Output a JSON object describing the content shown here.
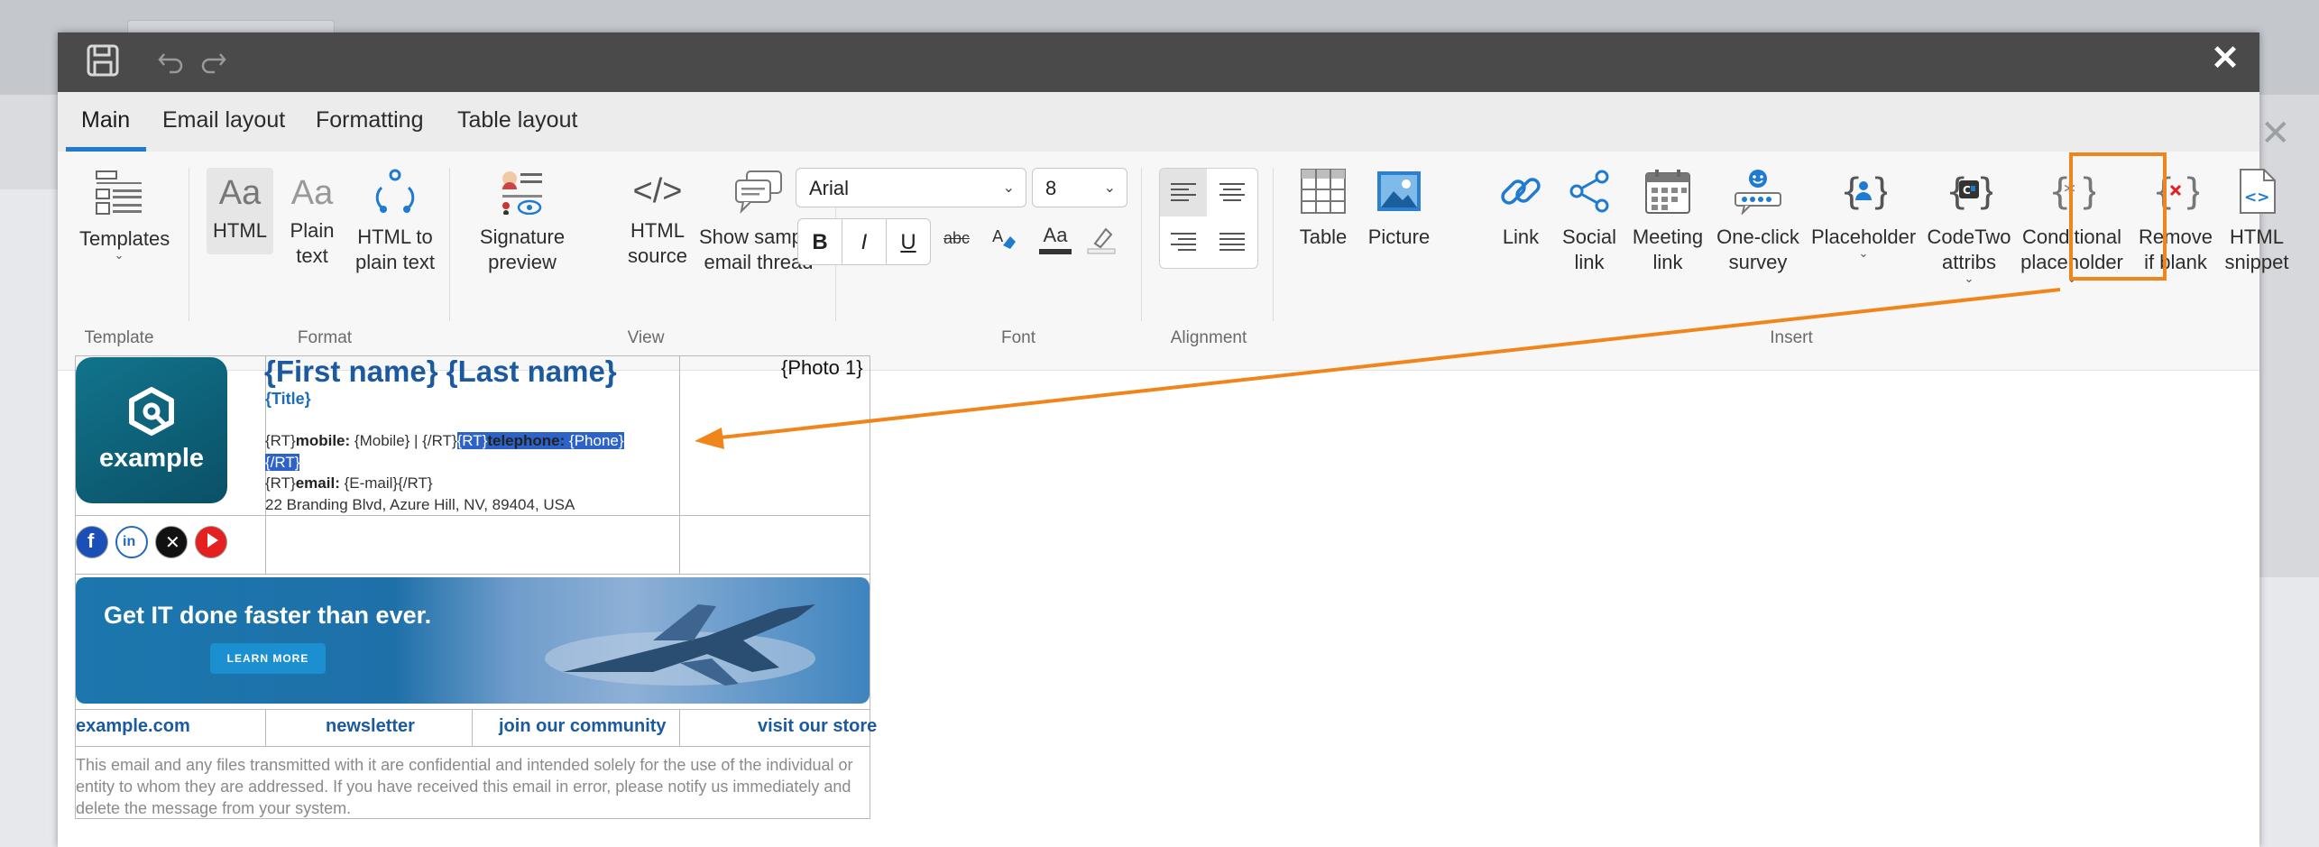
{
  "toolbar": {
    "save_icon": "save-icon",
    "undo_icon": "undo-icon",
    "redo_icon": "redo-icon",
    "close_label": "✕"
  },
  "tabs": [
    {
      "label": "Main",
      "active": true
    },
    {
      "label": "Email layout"
    },
    {
      "label": "Formatting"
    },
    {
      "label": "Table layout"
    }
  ],
  "ribbon": {
    "template": {
      "templates": "Templates",
      "group": "Template"
    },
    "format": {
      "html": "HTML",
      "plain_text_1": "Plain",
      "plain_text_2": "text",
      "html_to_plain_1": "HTML to",
      "html_to_plain_2": "plain text",
      "group": "Format"
    },
    "view": {
      "sig_preview_1": "Signature",
      "sig_preview_2": "preview",
      "html_source_1": "HTML",
      "html_source_2": "source",
      "sample_1": "Show sample",
      "sample_2": "email thread",
      "group": "View"
    },
    "font": {
      "family": "Arial",
      "size": "8",
      "bold": "B",
      "italic": "I",
      "underline": "U",
      "strike": "abc",
      "font_color": "Aa",
      "group": "Font"
    },
    "alignment": {
      "group": "Alignment"
    },
    "insert": {
      "table": "Table",
      "picture": "Picture",
      "link": "Link",
      "social_1": "Social",
      "social_2": "link",
      "meeting_1": "Meeting",
      "meeting_2": "link",
      "survey_1": "One-click",
      "survey_2": "survey",
      "placeholder": "Placeholder",
      "codetwo_1": "CodeTwo",
      "codetwo_2": "attribs",
      "conditional_1": "Conditional",
      "conditional_2": "placeholder",
      "remove_1": "Remove",
      "remove_2": "if blank",
      "snippet_1": "HTML",
      "snippet_2": "snippet",
      "group": "Insert"
    }
  },
  "signature": {
    "logo_text": "example",
    "name": "{First name} {Last name}",
    "title": "{Title}",
    "photo": "{Photo 1}",
    "mobile_prefix": "{RT}",
    "mobile_label": "mobile:",
    "mobile_value": " {Mobile}  |  {/RT}",
    "tel_highlight": "{RT}",
    "tel_label": "telephone:",
    "tel_value": " {Phone}",
    "tel_end": "{/RT}",
    "email_prefix": "{RT}",
    "email_label": "email:",
    "email_value": " {E-mail}{/RT}",
    "address": "22 Branding Blvd, Azure Hill, NV, 89404, USA",
    "banner_headline_1": "Get ",
    "banner_headline_bold": "IT",
    "banner_headline_2": " done faster than ever.",
    "banner_button": "LEARN MORE",
    "links": [
      "example.com",
      "newsletter",
      "join our community",
      "visit our store"
    ],
    "disclaimer": "This email and any files transmitted with it are confidential and intended solely for the use of the individual or entity to whom they are addressed. If you have received this email in error, please notify us immediately and delete the message from your system."
  },
  "colors": {
    "accent": "#1f7bd1",
    "highlight_box": "#f0861b",
    "arrow": "#f0861b",
    "name_blue": "#1c5aa0"
  }
}
